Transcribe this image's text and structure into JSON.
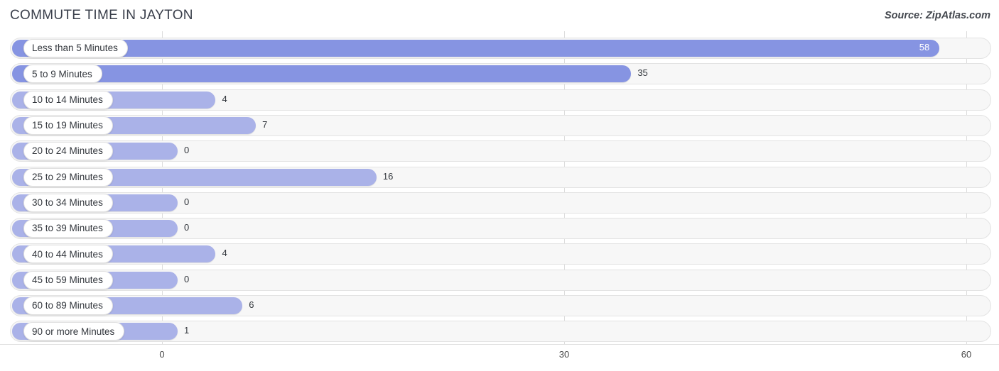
{
  "header": {
    "title": "COMMUTE TIME IN JAYTON",
    "source": "Source: ZipAtlas.com"
  },
  "chart_data": {
    "type": "bar",
    "orientation": "horizontal",
    "title": "COMMUTE TIME IN JAYTON",
    "xlabel": "",
    "ylabel": "",
    "xlim": [
      0,
      60
    ],
    "ticks": [
      0,
      30,
      60
    ],
    "tick_labels": [
      "0",
      "30",
      "60"
    ],
    "grid": true,
    "legend": null,
    "bar_color": "#8694e2",
    "track_color": "#f7f7f7",
    "categories": [
      "Less than 5 Minutes",
      "5 to 9 Minutes",
      "10 to 14 Minutes",
      "15 to 19 Minutes",
      "20 to 24 Minutes",
      "25 to 29 Minutes",
      "30 to 34 Minutes",
      "35 to 39 Minutes",
      "40 to 44 Minutes",
      "45 to 59 Minutes",
      "60 to 89 Minutes",
      "90 or more Minutes"
    ],
    "values": [
      58,
      35,
      4,
      7,
      0,
      16,
      0,
      0,
      4,
      0,
      6,
      1
    ],
    "value_labels": [
      "58",
      "35",
      "4",
      "7",
      "0",
      "16",
      "0",
      "0",
      "4",
      "0",
      "6",
      "1"
    ]
  }
}
